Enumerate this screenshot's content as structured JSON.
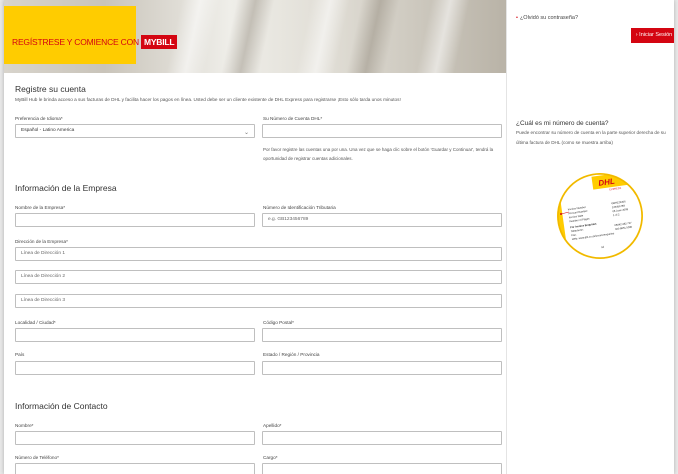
{
  "banner": {
    "text": "REGÍSTRESE Y COMIENCE CON",
    "badge": "MYBILL"
  },
  "login": {
    "forgot_password": "¿Olvidó su contraseña?",
    "login_button": "Iniciar Sesión"
  },
  "account_help": {
    "question": "¿Cuál es mi número de cuenta?",
    "description": "Puede encontrar su número de cuenta en la parte superior derecha de su última factura de DHL (como se muestra arriba)"
  },
  "register": {
    "title": "Registre su cuenta",
    "intro": "MyBill Hub le brinda acceso a sus facturas de DHL y facilita hacer los pagos en línea. Usted debe ser un cliente existente de DHL Express para registrarse ¡Esto sólo tarda unos minutos!",
    "language_label": "Preferencia de Idioma*",
    "language_value": "Español - Latino America",
    "account_label": "Su Número de Cuenta DHL*",
    "account_value": "",
    "account_hint": "Por favor registre las cuentas una por una. Una vez que se haga clic sobre el botón 'Guardar y Continuar', tendrá la oportunidad de registrar cuentas adicionales."
  },
  "company": {
    "title": "Información de la Empresa",
    "name_label": "Nombre de la Empresa*",
    "name_value": "",
    "tax_label": "Número de Identificación Tributaria",
    "tax_placeholder": "e.g. GB123456789",
    "address_label": "Dirección de la Empresa*",
    "address1_placeholder": "Línea de Dirección 1",
    "address2_placeholder": "Línea de Dirección 2",
    "address3_placeholder": "Línea de Dirección 3",
    "city_label": "Localidad / Ciudad*",
    "city_value": "",
    "postal_label": "Código Postal*",
    "postal_value": "",
    "country_label": "País",
    "country_value": "",
    "state_label": "Estado / Región / Provincia",
    "state_value": ""
  },
  "contact": {
    "title": "Información de Contacto",
    "first_name_label": "Nombre*",
    "first_name_value": "",
    "last_name_label": "Apellido*",
    "last_name_value": "",
    "phone_label": "Número de Teléfono*",
    "phone_value": "",
    "position_label": "Cargo*",
    "position_value": ""
  },
  "invoice_sample": {
    "logo": "DHL",
    "sub": "EXPRESS",
    "lines": [
      [
        "Invoice Number",
        "GBH123456"
      ],
      [
        "Account Number",
        "123456789"
      ],
      [
        "Invoice Date",
        "08 June 2008"
      ],
      [
        "Number of Pages",
        "1 of 2"
      ]
    ],
    "enquiries": "For Invoice Enquiries",
    "tel_label": "Telephone:",
    "tel_value": "08442 482 737",
    "fax_label": "Fax:",
    "fax_value": "020 8831 5390",
    "web": "Web: www.dhl.co.uk/invoiceenquiries",
    "footer": "tel"
  },
  "colors": {
    "dhl_red": "#d40511",
    "dhl_yellow": "#ffcc00"
  }
}
